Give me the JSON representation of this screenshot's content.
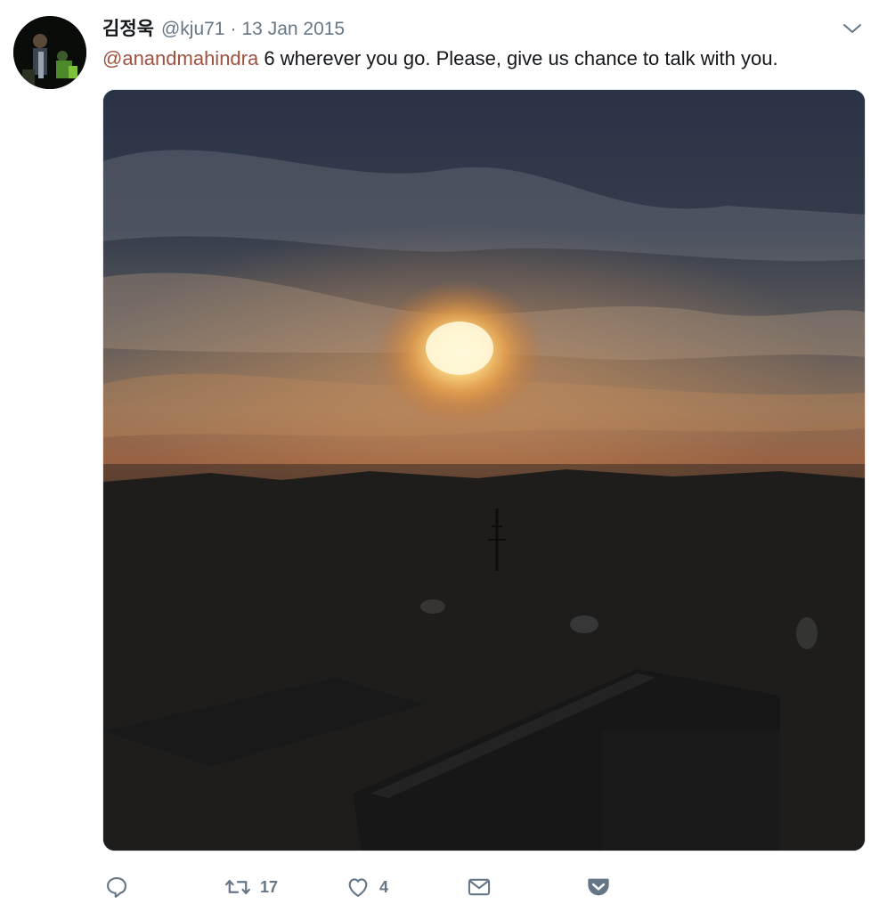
{
  "tweet": {
    "author": {
      "display_name": "김정욱",
      "handle": "@kju71"
    },
    "separator": "·",
    "timestamp": "13 Jan 2015",
    "mention": "@anandmahindra",
    "text": " 6 wherever you go. Please, give us chance to talk with you.",
    "media_alt": "Sunset over hazy industrial cityscape",
    "colors": {
      "mention": "#a0523f",
      "secondary": "#657786",
      "primary": "#14171a"
    }
  },
  "actions": {
    "reply": {
      "icon": "reply-icon"
    },
    "retweet": {
      "icon": "retweet-icon",
      "count": "17"
    },
    "like": {
      "icon": "heart-icon",
      "count": "4"
    },
    "message": {
      "icon": "mail-icon"
    },
    "pocket": {
      "icon": "pocket-icon"
    }
  }
}
